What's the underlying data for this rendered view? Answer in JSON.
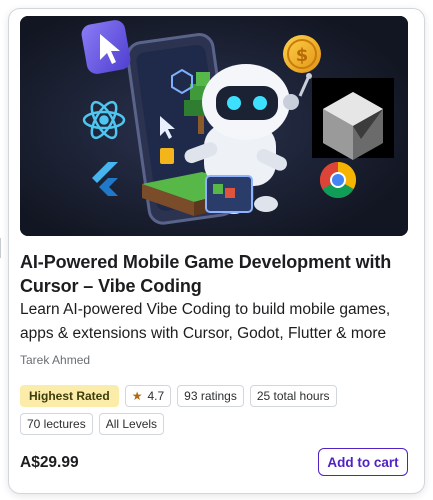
{
  "course": {
    "title": "AI-Powered Mobile Game Development with Cursor – Vibe Coding",
    "subtitle": "Learn AI-powered Vibe Coding to build mobile games, apps & extensions with Cursor, Godot, Flutter & more",
    "author": "Tarek Ahmed",
    "badge_label": "Highest Rated",
    "rating": "4.7",
    "ratings_count": "93 ratings",
    "total_hours": "25 total hours",
    "lectures": "70 lectures",
    "level": "All Levels",
    "price": "A$29.99",
    "add_to_cart": "Add to cart"
  },
  "thumbnail": {
    "icons": [
      "cursor-app-icon",
      "react-icon",
      "flutter-icon",
      "dollar-coin-icon",
      "cursor-cube-logo",
      "chrome-icon",
      "robot-illustration",
      "phone-illustration"
    ]
  },
  "colors": {
    "accent": "#5022c3",
    "badge_bg": "#fceca9",
    "star": "#b4690e"
  }
}
